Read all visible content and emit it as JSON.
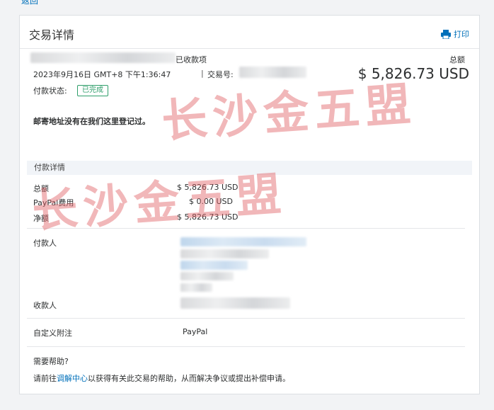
{
  "nav": {
    "back_label": "返回"
  },
  "header": {
    "title": "交易详情",
    "print_label": "打印"
  },
  "transaction": {
    "type_suffix": "已收款项",
    "date": "2023年9月16日 GMT+8 下午1:36:47",
    "id_label": "交易号:",
    "total_label": "总额",
    "total_amount": "$ 5,826.73 USD",
    "status_label": "付款状态:",
    "status_value": "已完成",
    "address_note": "邮寄地址没有在我们这里登记过。"
  },
  "payment_details": {
    "heading": "付款详情",
    "rows": [
      {
        "label": "总额",
        "value": "$ 5,826.73 USD"
      },
      {
        "label": "PayPal费用",
        "value": "$ 0.00 USD"
      },
      {
        "label": "净额",
        "value": "$ 5,826.73 USD"
      }
    ]
  },
  "parties": {
    "payer_label": "付款人",
    "payee_label": "收款人",
    "custom_note_label": "自定义附注",
    "custom_note_value": "PayPal"
  },
  "help": {
    "heading": "需要帮助?",
    "text_prefix": "请前往",
    "link_label": "调解中心",
    "text_suffix": "以获得有关此交易的帮助，从而解决争议或提出补偿申请。"
  },
  "watermark": {
    "text": "长沙金五盟"
  },
  "colors": {
    "accent": "#0070ba",
    "success": "#2e9e6a",
    "watermark": "#e15f64"
  }
}
